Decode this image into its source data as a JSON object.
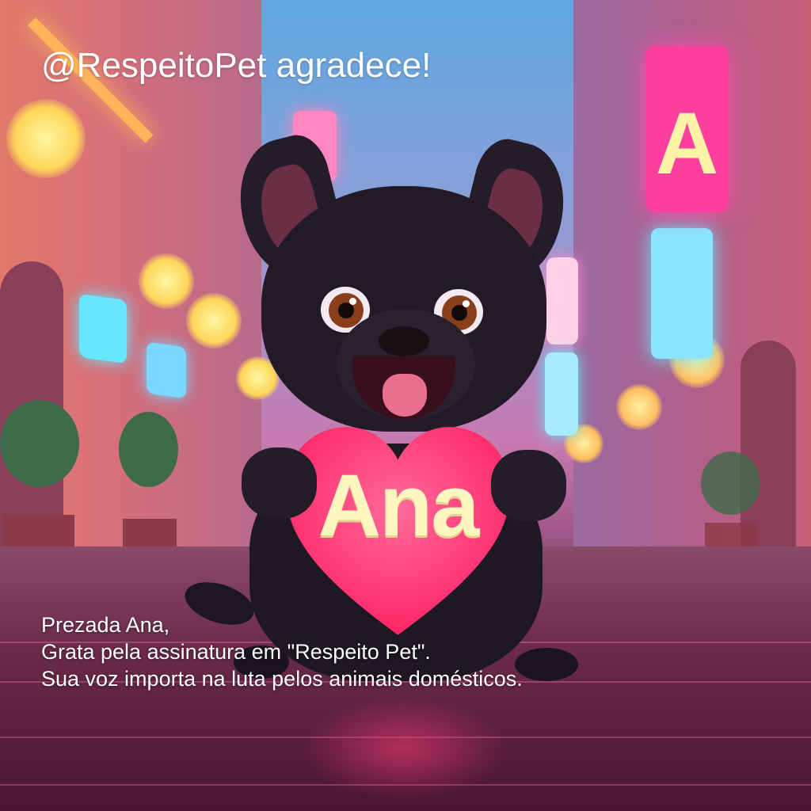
{
  "header": {
    "text": "@RespeitoPet agradece!"
  },
  "heart": {
    "name": "Ana",
    "color": "#ff2b6e"
  },
  "message": {
    "greeting": "Prezada Ana,",
    "line1": "Grata pela assinatura em \"Respeito Pet\".",
    "line2": "Sua voz importa na luta pelos animais domésticos."
  },
  "colors": {
    "sky": "#5fa8e0",
    "neon_pink": "#ff3fa0",
    "neon_cyan": "#66e6ff",
    "lamp_glow": "#ffe27a",
    "dog_fur": "#221b27"
  }
}
